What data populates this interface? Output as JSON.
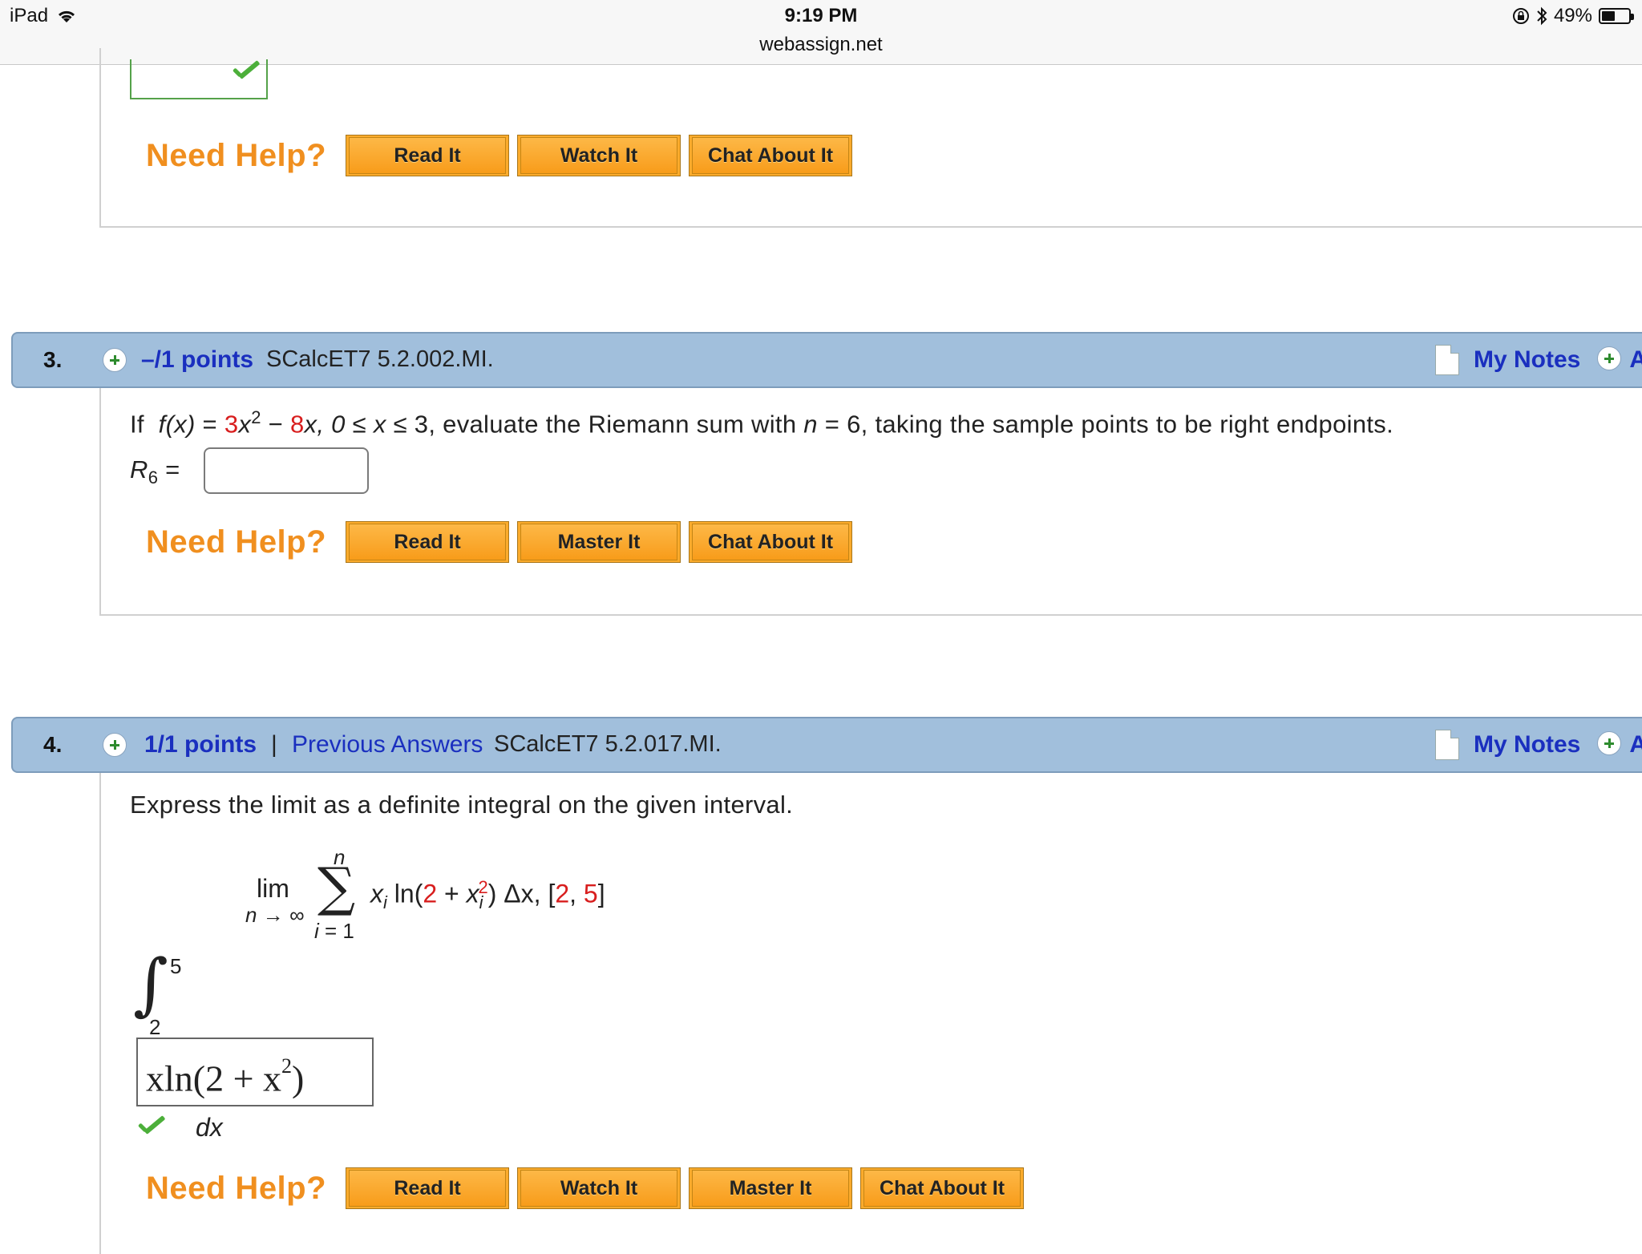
{
  "status_bar": {
    "device": "iPad",
    "time": "9:19 PM",
    "url": "webassign.net",
    "battery_text": "49%",
    "battery_level": 0.49
  },
  "q2": {
    "need_help": "Need Help?",
    "buttons": [
      "Read It",
      "Watch It",
      "Chat About It"
    ]
  },
  "q3": {
    "number": "3.",
    "points": "–/1 points",
    "code": "SCalcET7 5.2.002.MI.",
    "my_notes": "My Notes",
    "edge_letter": "A",
    "text": {
      "if": "If",
      "fx": "f(x)",
      "eq": " = ",
      "c1": "3",
      "x1": "x",
      "exp": "2",
      "minus": " − ",
      "c2": "8",
      "x2": "x, 0 ≤ ",
      "xvar": "x",
      "rest1": " ≤ 3,  evaluate the Riemann sum with ",
      "n": "n",
      "rest2": " = 6, taking the sample points to be right endpoints."
    },
    "r_label": "R",
    "r_sub": "6",
    "r_eq": " =",
    "answer_value": "",
    "need_help": "Need Help?",
    "buttons": [
      "Read It",
      "Master It",
      "Chat About It"
    ]
  },
  "q4": {
    "number": "4.",
    "points": "1/1 points",
    "separator": "|",
    "previous_answers": "Previous Answers",
    "code": "SCalcET7 5.2.017.MI.",
    "my_notes": "My Notes",
    "edge_letter": "A",
    "prompt": "Express the limit as a definite integral on the given interval.",
    "limit": {
      "lim": "lim",
      "under": "n → ∞",
      "sigma": "∑",
      "top": "n",
      "bottom": "i = 1",
      "xi": "x",
      "xi_sub": "i",
      "ln_open": " ln(",
      "two": "2",
      "plus": " + ",
      "xi2": "x",
      "xi2_sub": "i",
      "xi2_exp": "2",
      "close": ") Δx, [",
      "a": "2",
      "comma": ", ",
      "b": "5",
      "bracket": "]"
    },
    "integral_upper": "5",
    "integral_lower": "2",
    "integral_sign": "∫",
    "answer_expr": "xln(2 + x",
    "answer_exp": "2",
    "answer_close": ")",
    "dx": "dx",
    "need_help": "Need Help?",
    "buttons": [
      "Read It",
      "Watch It",
      "Master It",
      "Chat About It"
    ]
  },
  "colors": {
    "header_blue": "#a1bfdc",
    "link_blue": "#1a2fbf",
    "help_orange": "#f08f1f",
    "button_orange": "#fbab2c",
    "red": "#d81e1e",
    "check_green": "#4caf3a"
  }
}
